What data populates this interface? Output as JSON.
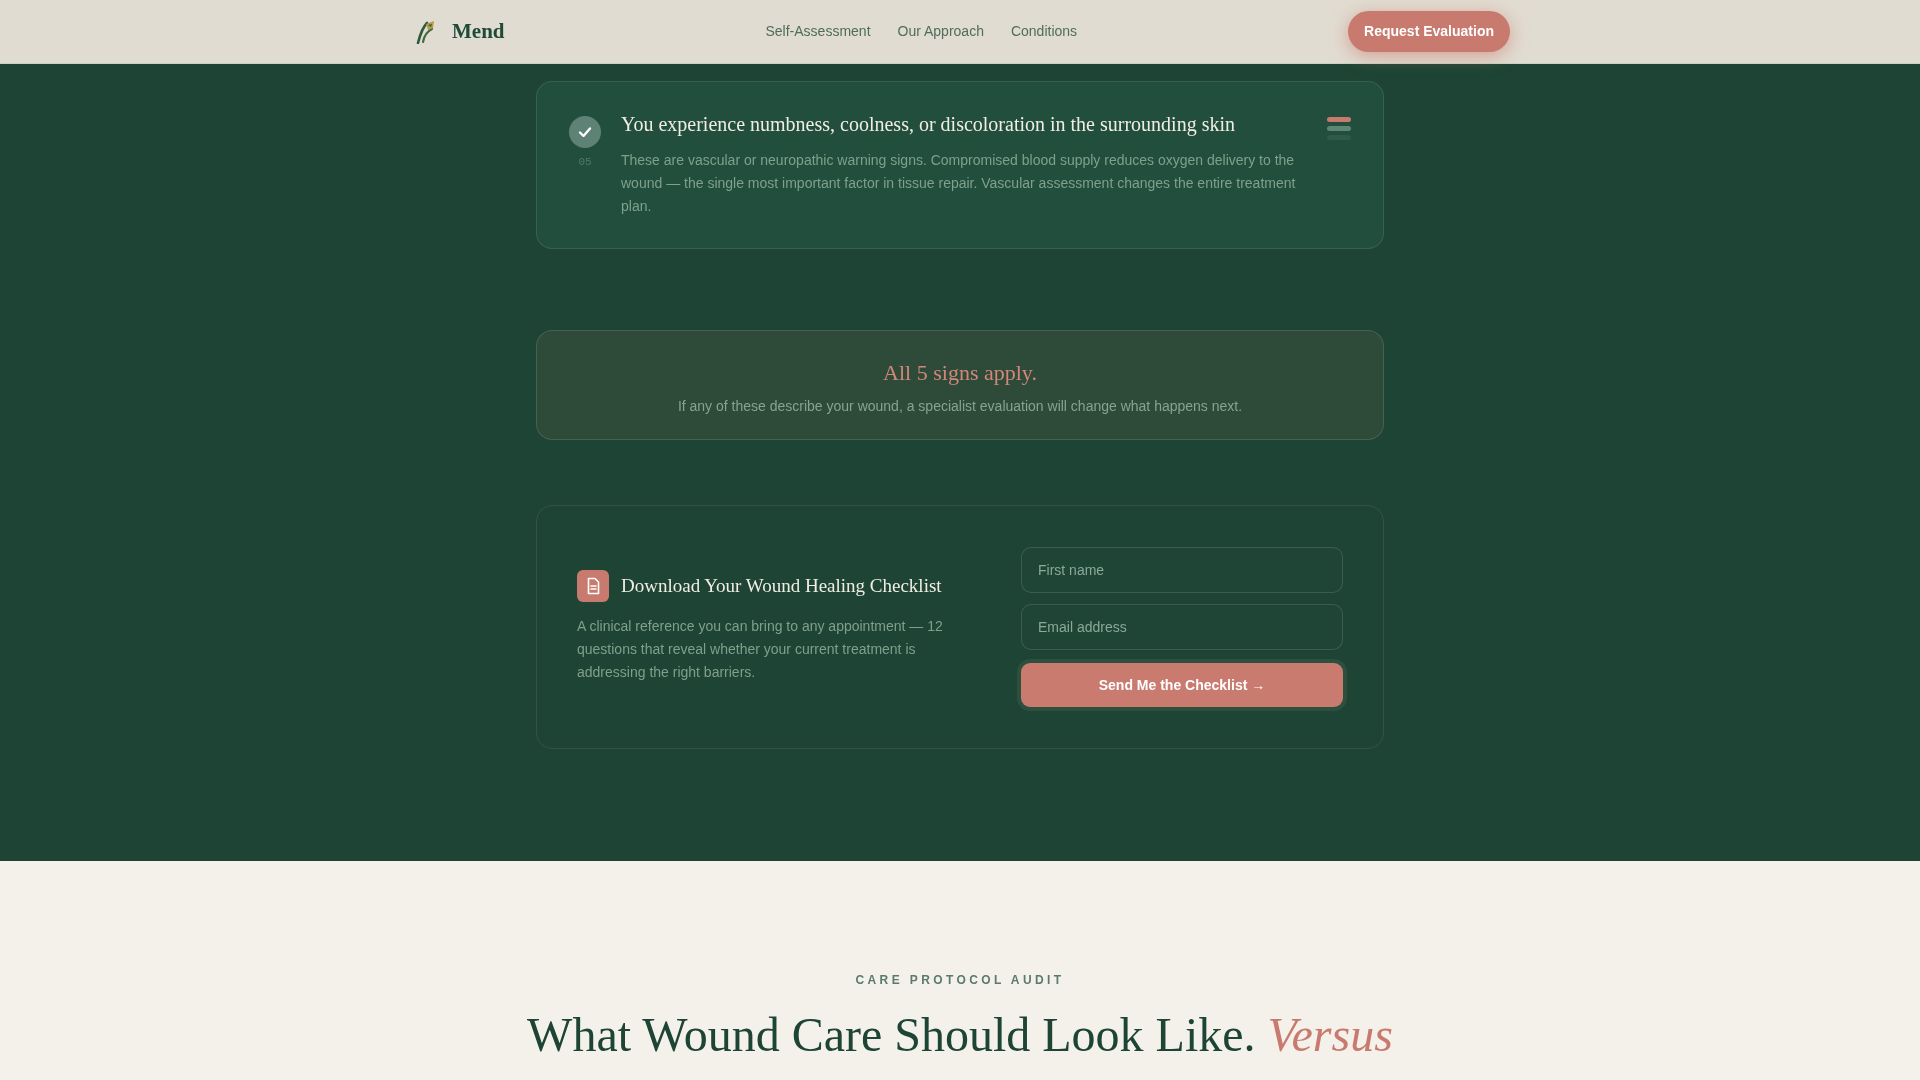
{
  "nav": {
    "brand": "Mend",
    "links": [
      {
        "label": "Self-Assessment"
      },
      {
        "label": "Our Approach"
      },
      {
        "label": "Conditions"
      }
    ],
    "cta": "Request Evaluation"
  },
  "signs": [
    {
      "number": "05",
      "checked": true,
      "title": "You experience numbness, coolness, or discoloration in the surrounding skin",
      "description": "These are vascular or neuropathic warning signs. Compromised blood supply reduces oxygen delivery to the wound — the single most important factor in tissue repair. Vascular assessment changes the entire treatment plan."
    }
  ],
  "summary": {
    "title": "All 5 signs apply.",
    "text": "If any of these describe your wound, a specialist evaluation will change what happens next."
  },
  "checklist": {
    "title": "Download Your Wound Healing Checklist",
    "description": "A clinical reference you can bring to any appointment — 12 questions that reveal whether your current treatment is addressing the right barriers.",
    "fields": [
      {
        "placeholder": "First name"
      },
      {
        "placeholder": "Email address"
      }
    ],
    "button": "Send Me the Checklist →"
  },
  "audit": {
    "eyebrow": "CARE PROTOCOL AUDIT",
    "heading": "What Wound Care Should Look Like. *Versus*"
  }
}
